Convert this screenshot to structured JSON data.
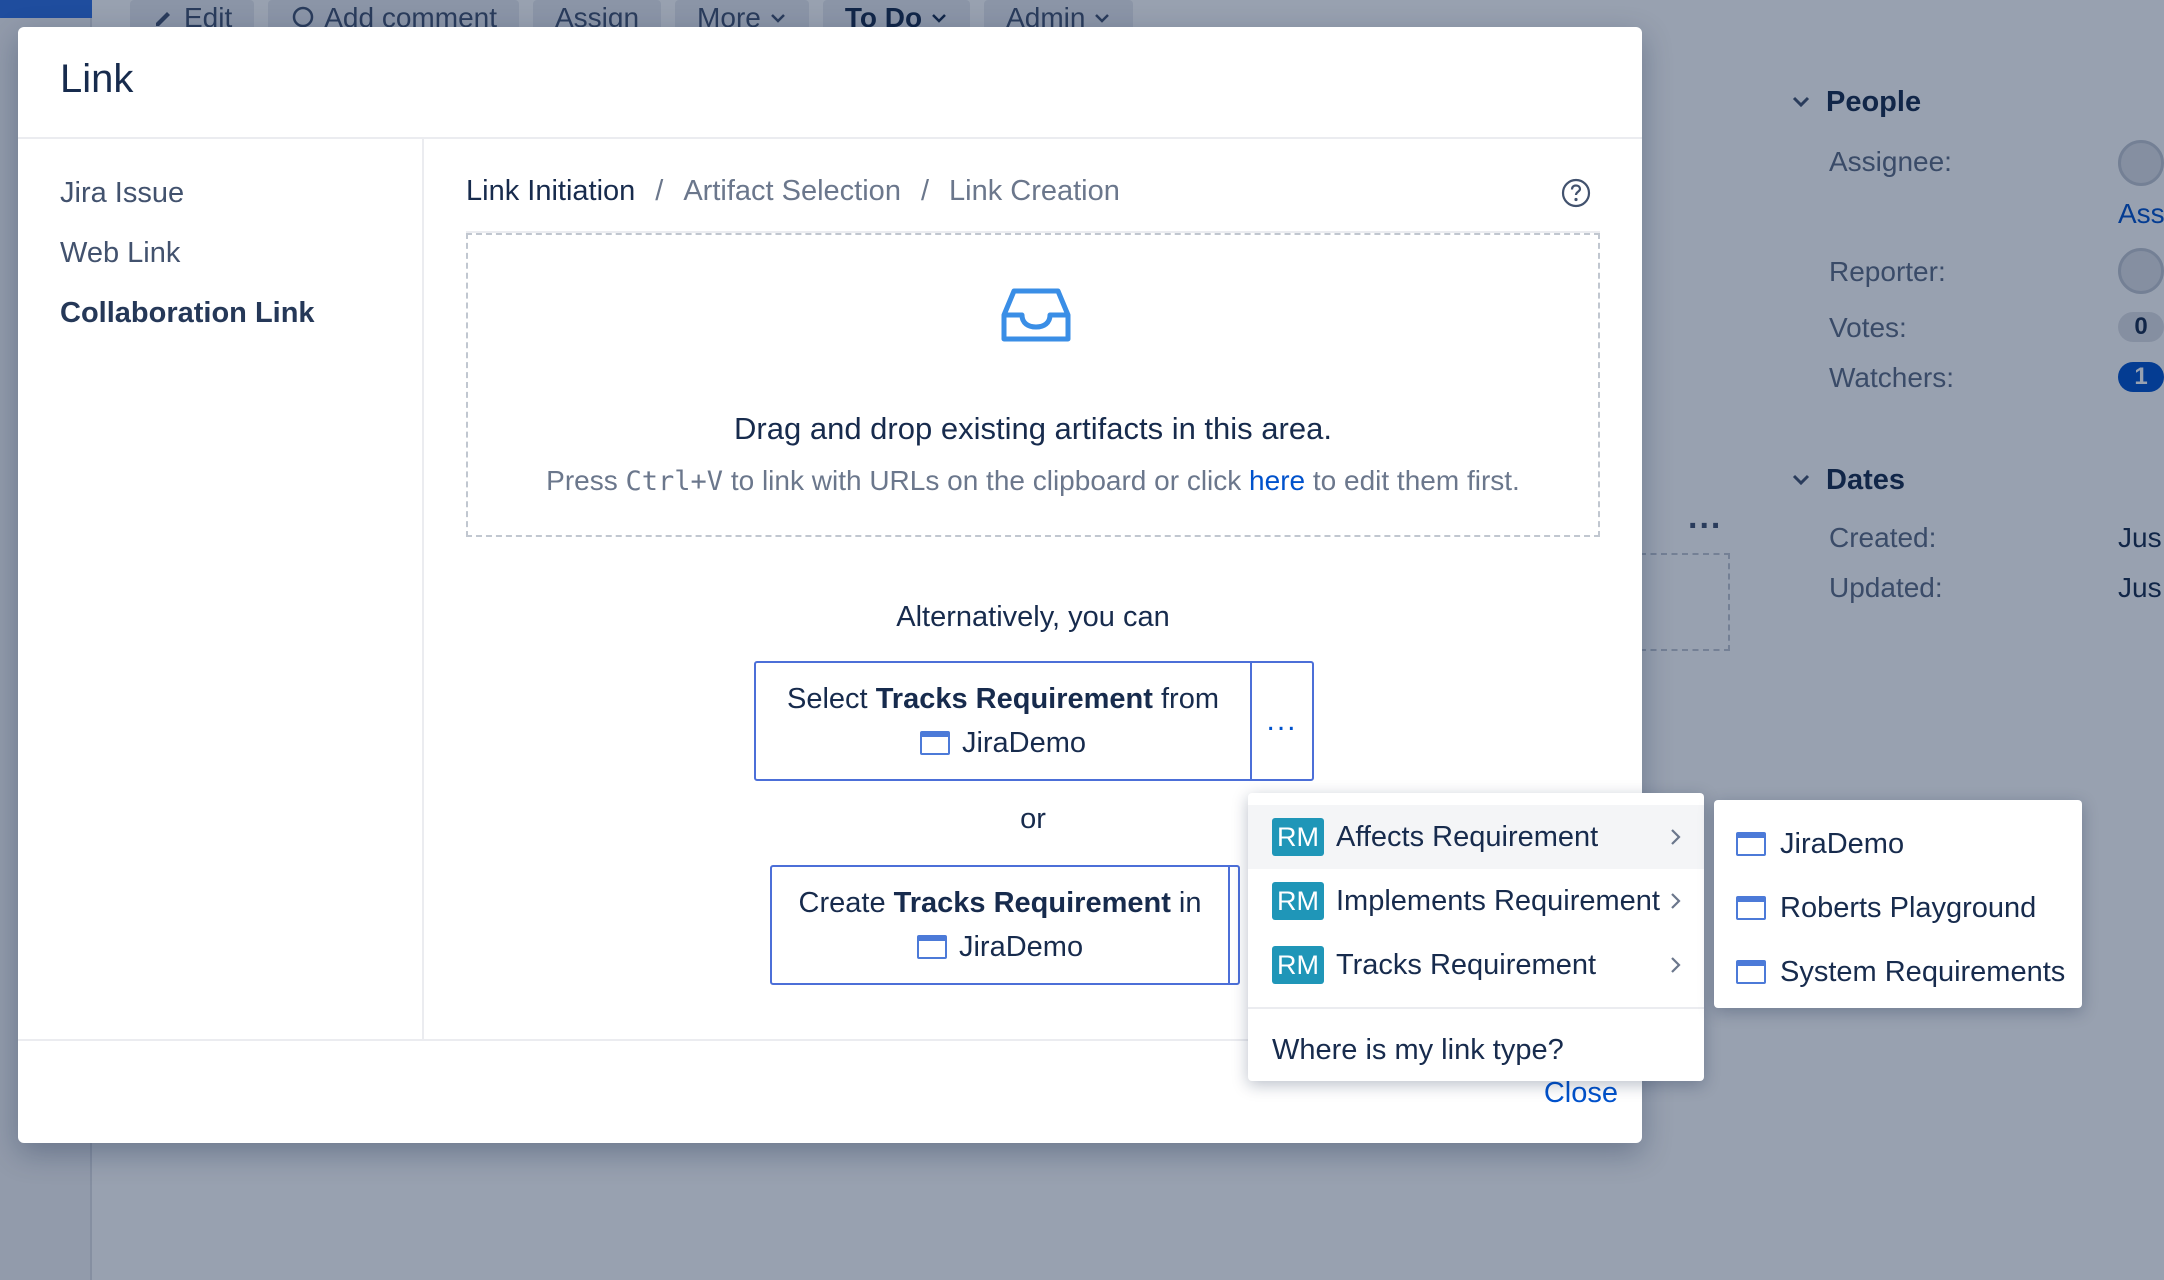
{
  "background": {
    "toolbar": [
      "Edit",
      "Add comment",
      "Assign",
      "More",
      "To Do",
      "Admin"
    ],
    "people": {
      "title": "People",
      "assignee_label": "Assignee:",
      "assignee_value": "Ass",
      "reporter_label": "Reporter:",
      "votes_label": "Votes:",
      "votes_value": "0",
      "watchers_label": "Watchers:",
      "watchers_value": "1"
    },
    "dates": {
      "title": "Dates",
      "created_label": "Created:",
      "created_value": "Jus",
      "updated_label": "Updated:",
      "updated_value": "Jus"
    },
    "ellipsis": "..."
  },
  "modal": {
    "title": "Link",
    "nav": [
      "Jira Issue",
      "Web Link",
      "Collaboration Link"
    ],
    "breadcrumb": [
      "Link Initiation",
      "Artifact Selection",
      "Link Creation"
    ],
    "breadcrumb_separator": "/",
    "drop": {
      "title": "Drag and drop existing artifacts in this area.",
      "hint_before": "Press ",
      "hint_key": "Ctrl+V",
      "hint_middle": " to link with URLs on the clipboard or click ",
      "hint_link": "here",
      "hint_after": " to edit them first."
    },
    "alternatively": "Alternatively, you can",
    "select_action": {
      "prefix": "Select ",
      "type": "Tracks Requirement",
      "suffix": " from",
      "project": "JiraDemo",
      "more": "..."
    },
    "or": "or",
    "create_action": {
      "prefix": "Create ",
      "type": "Tracks Requirement",
      "suffix": " in",
      "project": "JiraDemo"
    },
    "close": "Close"
  },
  "link_type_menu": {
    "items": [
      {
        "badge": "RM",
        "label": "Affects Requirement"
      },
      {
        "badge": "RM",
        "label": "Implements Requirement"
      },
      {
        "badge": "RM",
        "label": "Tracks Requirement"
      }
    ],
    "help": "Where is my link type?"
  },
  "project_menu": {
    "items": [
      "JiraDemo",
      "Roberts Playground",
      "System Requirements"
    ]
  },
  "colors": {
    "accent": "#0052cc",
    "rm_badge": "#1f96b8",
    "overlay": "rgba(9,30,66,0.42)",
    "watchers_badge": "#0052cc"
  }
}
